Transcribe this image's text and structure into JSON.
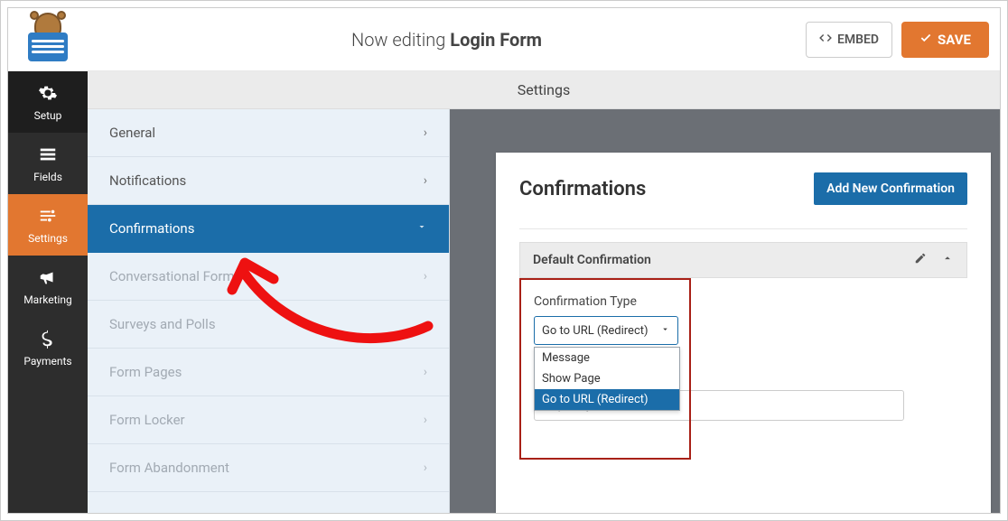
{
  "header": {
    "now_editing": "Now editing",
    "form_name": "Login Form",
    "embed": "EMBED",
    "save": "SAVE"
  },
  "nav": {
    "items": [
      {
        "label": "Setup",
        "icon": "gear"
      },
      {
        "label": "Fields",
        "icon": "list"
      },
      {
        "label": "Settings",
        "icon": "sliders"
      },
      {
        "label": "Marketing",
        "icon": "bullhorn"
      },
      {
        "label": "Payments",
        "icon": "dollar"
      }
    ],
    "active_index": 2
  },
  "panel_title": "Settings",
  "settings_menu": {
    "items": [
      {
        "label": "General",
        "enabled": true
      },
      {
        "label": "Notifications",
        "enabled": true
      },
      {
        "label": "Confirmations",
        "enabled": true
      },
      {
        "label": "Conversational Forms",
        "enabled": false
      },
      {
        "label": "Surveys and Polls",
        "enabled": false
      },
      {
        "label": "Form Pages",
        "enabled": false
      },
      {
        "label": "Form Locker",
        "enabled": false
      },
      {
        "label": "Form Abandonment",
        "enabled": false
      }
    ],
    "active_index": 2
  },
  "confirmations": {
    "heading": "Confirmations",
    "add_button": "Add New Confirmation",
    "accordion_title": "Default Confirmation",
    "field_label": "Confirmation Type",
    "select_value": "Go to URL (Redirect)",
    "options": [
      "Message",
      "Show Page",
      "Go to URL (Redirect)"
    ],
    "highlighted_option_index": 2,
    "url_value": "http://mytestsite.com"
  }
}
